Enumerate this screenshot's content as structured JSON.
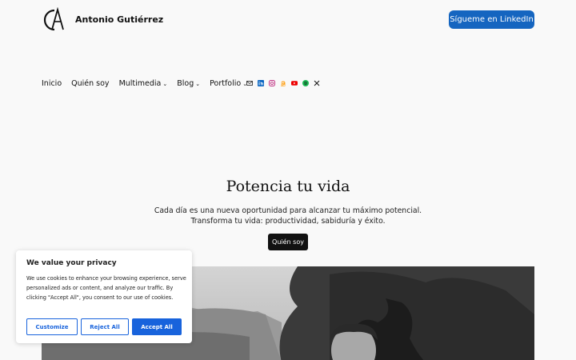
{
  "header": {
    "site_title": "Antonio Gutiérrez",
    "cta_label": "Sígueme en LinkedIn"
  },
  "nav": {
    "items": [
      {
        "label": "Inicio",
        "has_dropdown": false
      },
      {
        "label": "Quién soy",
        "has_dropdown": false
      },
      {
        "label": "Multimedia",
        "has_dropdown": true
      },
      {
        "label": "Blog",
        "has_dropdown": true
      },
      {
        "label": "Portfolio",
        "has_dropdown": true
      }
    ],
    "social_icons": [
      "mail-icon",
      "linkedin-icon",
      "instagram-icon",
      "amazon-icon",
      "youtube-icon",
      "spotify-icon",
      "x-icon"
    ]
  },
  "hero": {
    "title": "Potencia tu vida",
    "subtitle_line1": "Cada día es una nueva oportunidad para alcanzar tu máximo potencial.",
    "subtitle_line2": "Transforma tu vida: productividad, sabiduría y éxito.",
    "button_label": "Quién soy"
  },
  "cookie_banner": {
    "title": "We value your privacy",
    "text": "We use cookies to enhance your browsing experience, serve personalized ads or content, and analyze our traffic. By clicking \"Accept All\", you consent to our use of cookies.",
    "customize_label": "Customize",
    "reject_label": "Reject All",
    "accept_label": "Accept All"
  },
  "colors": {
    "linkedin_button": "#1565c0",
    "cookie_accent": "#1863dc",
    "hero_button": "#111111"
  }
}
